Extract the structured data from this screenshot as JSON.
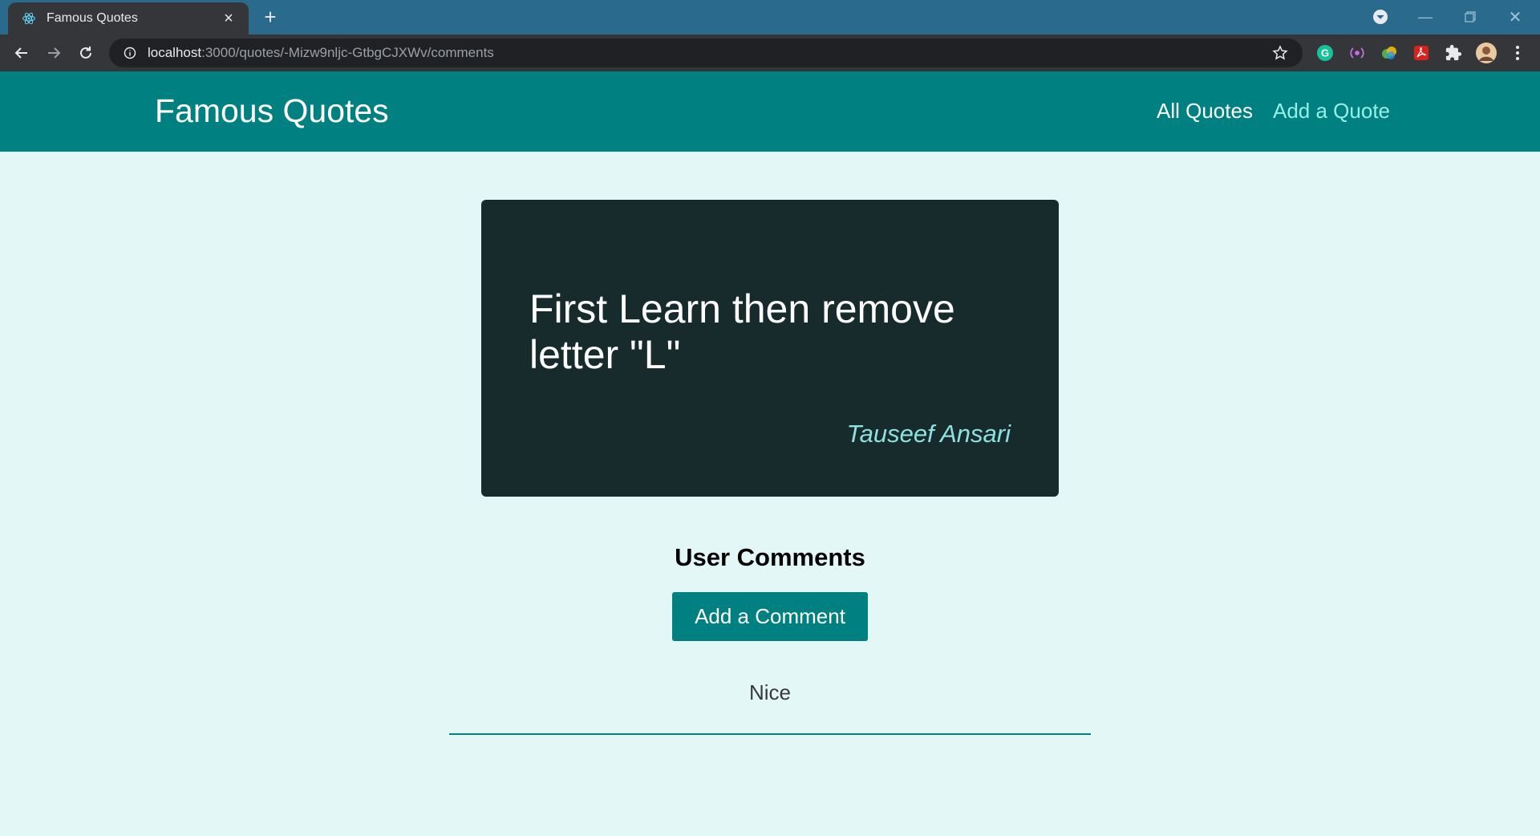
{
  "browser": {
    "tab_title": "Famous Quotes",
    "url_host": "localhost",
    "url_rest": ":3000/quotes/-Mizw9nljc-GtbgCJXWv/comments"
  },
  "header": {
    "logo": "Famous Quotes",
    "nav": [
      {
        "label": "All Quotes"
      },
      {
        "label": "Add a Quote"
      }
    ]
  },
  "quote": {
    "text": "First Learn then remove letter \"L\"",
    "author": "Tauseef Ansari"
  },
  "comments": {
    "title": "User Comments",
    "add_button": "Add a Comment",
    "items": [
      {
        "text": "Nice"
      }
    ]
  },
  "colors": {
    "primary": "#008080",
    "background": "#e4f7f7",
    "card": "#172a2c",
    "author": "#8fe0e0",
    "active_link": "#95f0e6"
  }
}
